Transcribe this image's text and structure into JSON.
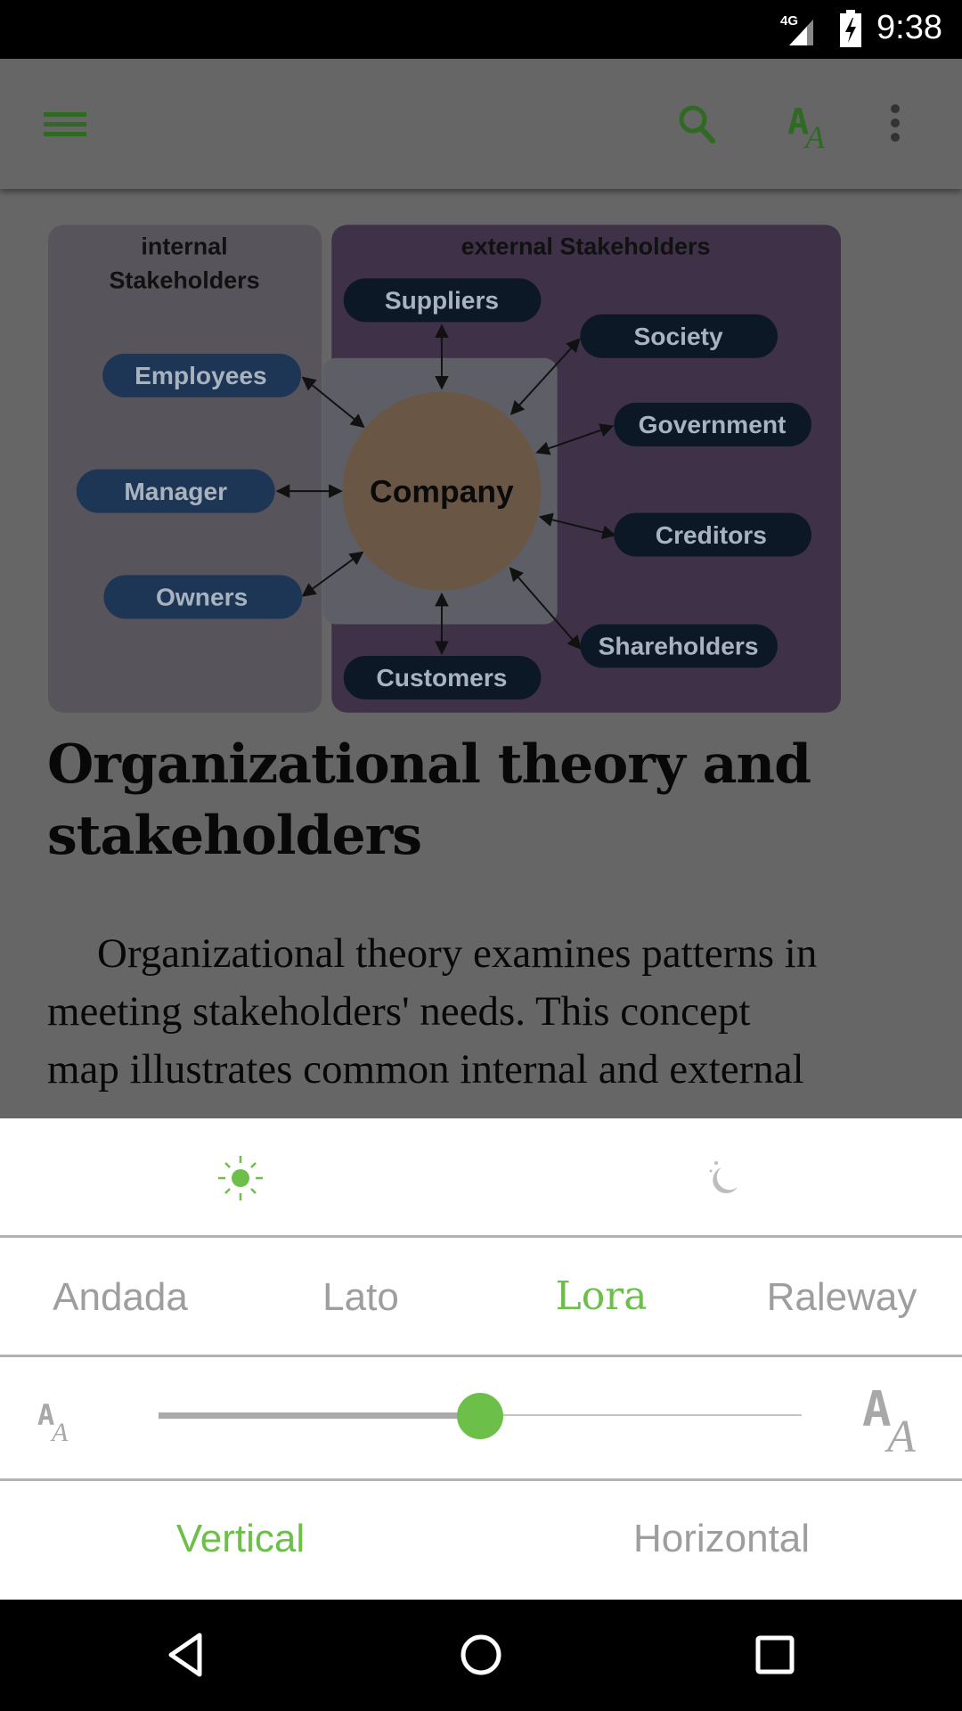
{
  "status_bar": {
    "network": "4G",
    "time": "9:38",
    "icons": [
      "signal-icon",
      "battery-charging-icon"
    ]
  },
  "toolbar": {
    "icons": [
      "menu-icon",
      "search-icon",
      "font-settings-icon",
      "more-options-icon"
    ],
    "accent": "#2f6a22"
  },
  "diagram": {
    "internal_title_1": "internal",
    "internal_title_2": "Stakeholders",
    "external_title": "external Stakeholders",
    "center": "Company",
    "internal": [
      "Employees",
      "Manager",
      "Owners"
    ],
    "external": [
      "Suppliers",
      "Society",
      "Government",
      "Creditors",
      "Shareholders",
      "Customers"
    ]
  },
  "article": {
    "title_lines": [
      "Organizational theory and",
      "stakeholders"
    ],
    "body_lines": [
      "Organizational theory examines patterns in",
      "meeting stakeholders' needs. This concept",
      "map illustrates common internal and external"
    ]
  },
  "settings_panel": {
    "themes": [
      {
        "name": "light",
        "icon": "sun-icon",
        "active": true
      },
      {
        "name": "dark",
        "icon": "moon-icon",
        "active": false
      }
    ],
    "fonts": [
      {
        "label": "Andada",
        "active": false
      },
      {
        "label": "Lato",
        "active": false
      },
      {
        "label": "Lora",
        "active": true
      },
      {
        "label": "Raleway",
        "active": false
      }
    ],
    "text_size": {
      "value_fraction": 0.5,
      "min_icon": "text-size-small-icon",
      "max_icon": "text-size-large-icon"
    },
    "orientation": [
      {
        "label": "Vertical",
        "active": true
      },
      {
        "label": "Horizontal",
        "active": false
      }
    ],
    "accent": "#6cc04a",
    "inactive": "#9e9e9e"
  },
  "nav_bar": {
    "icons": [
      "back-icon",
      "home-icon",
      "recents-icon"
    ]
  }
}
